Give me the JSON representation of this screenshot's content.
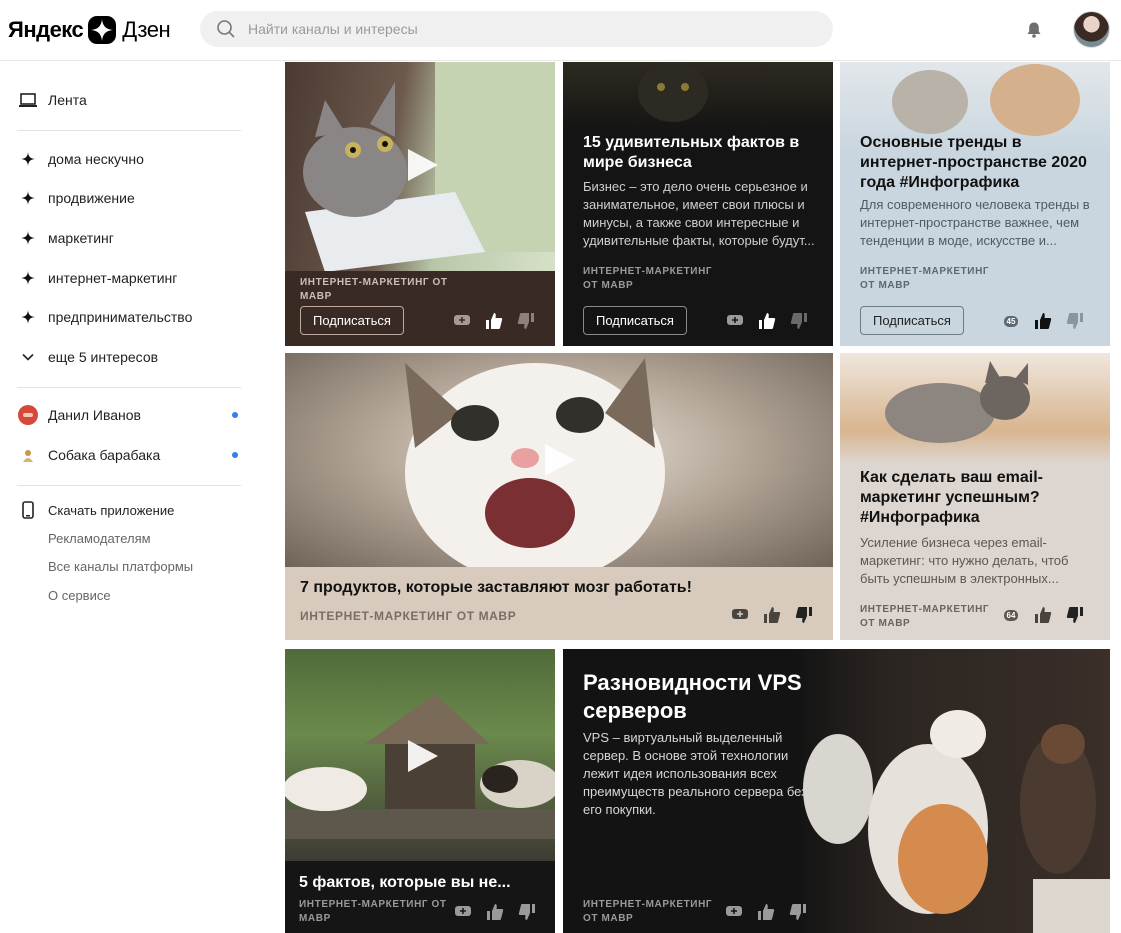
{
  "header": {
    "logo_word1": "Яндекс",
    "logo_word2": "Дзен",
    "search_placeholder": "Найти каналы и интересы"
  },
  "sidebar": {
    "feed": "Лента",
    "interests": [
      "дома нескучно",
      "продвижение",
      "маркетинг",
      "интернет-маркетинг",
      "предпринимательство"
    ],
    "more": "еще 5 интересов",
    "channels": [
      "Данил Иванов",
      "Собака барабака"
    ],
    "download": "Скачать приложение",
    "links": [
      "Рекламодателям",
      "Все каналы платформы",
      "О сервисе"
    ]
  },
  "cards": [
    {
      "source": "ИНТЕРНЕТ-МАРКЕТИНГ ОТ МАВР",
      "subscribe": "Подписаться"
    },
    {
      "title": "15 удивительных фактов в мире бизнеса",
      "desc": "Бизнес – это дело очень серьезное и занимательное, имеет свои плюсы и минусы, а также свои интересные и удивительные факты, которые будут...",
      "source": "ИНТЕРНЕТ-МАРКЕТИНГ ОТ МАВР",
      "subscribe": "Подписаться"
    },
    {
      "title": "Основные тренды в интернет-пространстве 2020 года #Инфографика",
      "desc": "Для современного человека тренды в интернет-пространстве важнее, чем тенденции в моде, искусстве и...",
      "source": "ИНТЕРНЕТ-МАРКЕТИНГ ОТ МАВР",
      "subscribe": "Подписаться",
      "comments": "45"
    },
    {
      "title": "7 продуктов, которые заставляют мозг работать!",
      "source": "ИНТЕРНЕТ-МАРКЕТИНГ ОТ МАВР"
    },
    {
      "title": "Как сделать ваш email-маркетинг успешным? #Инфографика",
      "desc": "Усиление бизнеса через email-маркетинг: что нужно делать, чтоб быть успешным в электронных...",
      "source": "ИНТЕРНЕТ-МАРКЕТИНГ ОТ МАВР",
      "comments": "64"
    },
    {
      "title": "5 фактов, которые вы не...",
      "source": "ИНТЕРНЕТ-МАРКЕТИНГ ОТ МАВР"
    },
    {
      "title": "Разновидности VPS серверов",
      "desc": "VPS – виртуальный выделенный сервер. В основе этой технологии лежит идея использования всех преимуществ реального сервера без его покупки.",
      "source": "ИНТЕРНЕТ-МАРКЕТИНГ ОТ МАВР"
    }
  ],
  "colors": {
    "accent_dot": "#2f80ed",
    "card1_bg": "#3a2a24",
    "card2_bg": "#141414",
    "card3_bg": "#c9d6df",
    "card4_bg": "#d8cbbd",
    "card5_bg": "#ddd5cf",
    "card6_bg": "#151515",
    "card7_bg": "#131313"
  }
}
